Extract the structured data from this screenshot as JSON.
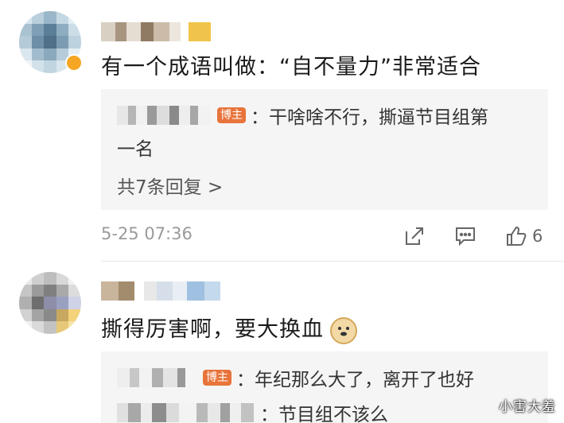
{
  "comments": [
    {
      "text": "有一个成语叫做：“自不量力”非常适合",
      "reply": {
        "badge": "博主",
        "text_line1": "：干啥啥不行，撕逼节目组第",
        "text_line2": "一名"
      },
      "more_replies": "共7条回复 >",
      "time": "5-25 07:36",
      "like_count": "6"
    },
    {
      "text": "撕得厉害啊，要大换血",
      "replies": [
        {
          "badge": "博主",
          "text": "：年纪那么大了，离开了也好"
        },
        {
          "badge": "",
          "text": "：节目组不该么"
        }
      ]
    }
  ],
  "icons": {
    "share": "share-icon",
    "comment": "comment-icon",
    "like": "thumbs-up-icon",
    "emoji": "doge-emoji-icon"
  },
  "watermark": "小害大羞",
  "colors": {
    "bozhu_badge": "#e8743b",
    "time_text": "#9a9a9a",
    "reply_bg": "#f5f5f5"
  }
}
